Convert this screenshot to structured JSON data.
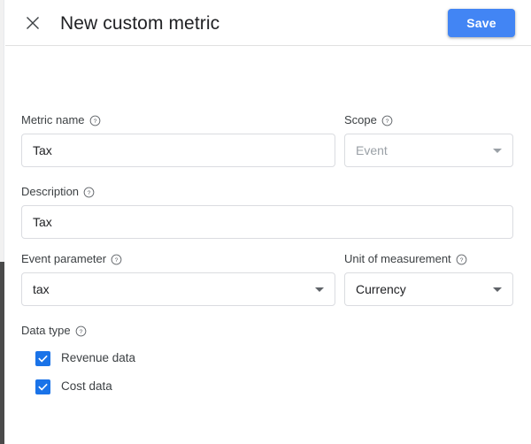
{
  "header": {
    "close_icon": "close-icon",
    "title": "New custom metric",
    "save_label": "Save",
    "save_color": "#4285f4"
  },
  "form": {
    "help_icon": "help-circle-icon",
    "metric_name": {
      "label": "Metric name",
      "value": "Tax",
      "placeholder": ""
    },
    "scope": {
      "label": "Scope",
      "value": "Event",
      "disabled": true,
      "caret_icon": "chevron-down-icon"
    },
    "description": {
      "label": "Description",
      "value": "Tax",
      "placeholder": ""
    },
    "event_parameter": {
      "label": "Event parameter",
      "value": "tax",
      "caret_icon": "chevron-down-icon"
    },
    "unit_of_measurement": {
      "label": "Unit of measurement",
      "value": "Currency",
      "caret_icon": "chevron-down-icon"
    },
    "data_type": {
      "label": "Data type",
      "options": [
        {
          "label": "Revenue data",
          "checked": true
        },
        {
          "label": "Cost data",
          "checked": true
        }
      ]
    }
  },
  "colors": {
    "accent": "#1a73e8",
    "save_button": "#4285f4",
    "border": "#dadce0",
    "text_primary": "#202124",
    "text_secondary": "#3c4043",
    "text_disabled": "#9aa0a6"
  }
}
